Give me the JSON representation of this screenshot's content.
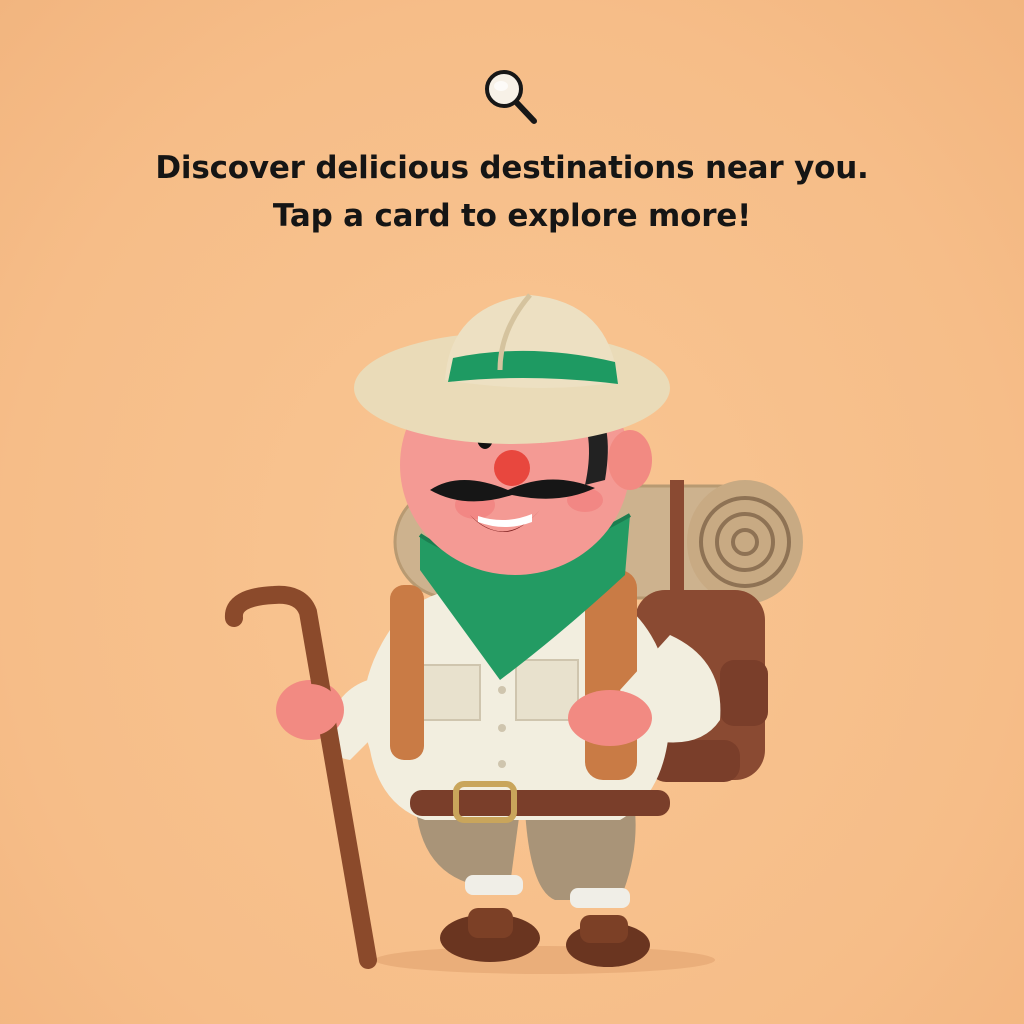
{
  "header": {
    "icon": "search-icon",
    "line1": "Discover delicious destinations near you.",
    "line2": "Tap a card to explore more!"
  },
  "illustration": {
    "name": "explorer-mascot",
    "colors": {
      "background": "#F8C08B",
      "hat": "#EADBB8",
      "hat_band": "#1E9A62",
      "bandana": "#239B63",
      "shirt": "#F2EEDF",
      "pants": "#A99478",
      "backpack": "#8A4A32",
      "strap": "#C97B45",
      "cane": "#8B4A2B"
    }
  }
}
